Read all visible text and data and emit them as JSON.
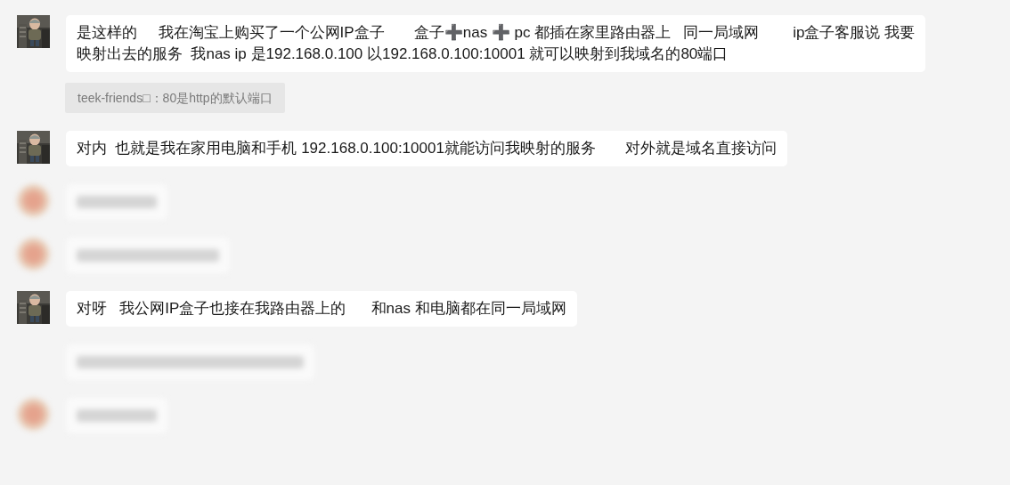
{
  "messages": [
    {
      "kind": "text",
      "avatar": true,
      "lines": [
        "是这样的     我在淘宝上购买了一个公网IP盒子       盒子➕nas ➕ pc 都插在家里路由器上   同一局域网        ip盒子客服说 我要",
        "映射出去的服务  我nas ip 是192.168.0.100 以192.168.0.100:10001 就可以映射到我域名的80端口"
      ]
    },
    {
      "kind": "note",
      "lines": [
        "teek-friends□：80是http的默认端口"
      ]
    },
    {
      "kind": "text",
      "avatar": true,
      "lines": [
        "对内  也就是我在家用电脑和手机 192.168.0.100:10001就能访问我映射的服务       对外就是域名直接访问"
      ]
    },
    {
      "kind": "blurred",
      "avatar": true
    },
    {
      "kind": "blurred",
      "avatar": true
    },
    {
      "kind": "text",
      "avatar": true,
      "lines": [
        "对呀   我公网IP盒子也接在我路由器上的      和nas 和电脑都在同一局域网"
      ]
    },
    {
      "kind": "blurred",
      "avatar": false
    },
    {
      "kind": "blurred",
      "avatar": true
    }
  ]
}
